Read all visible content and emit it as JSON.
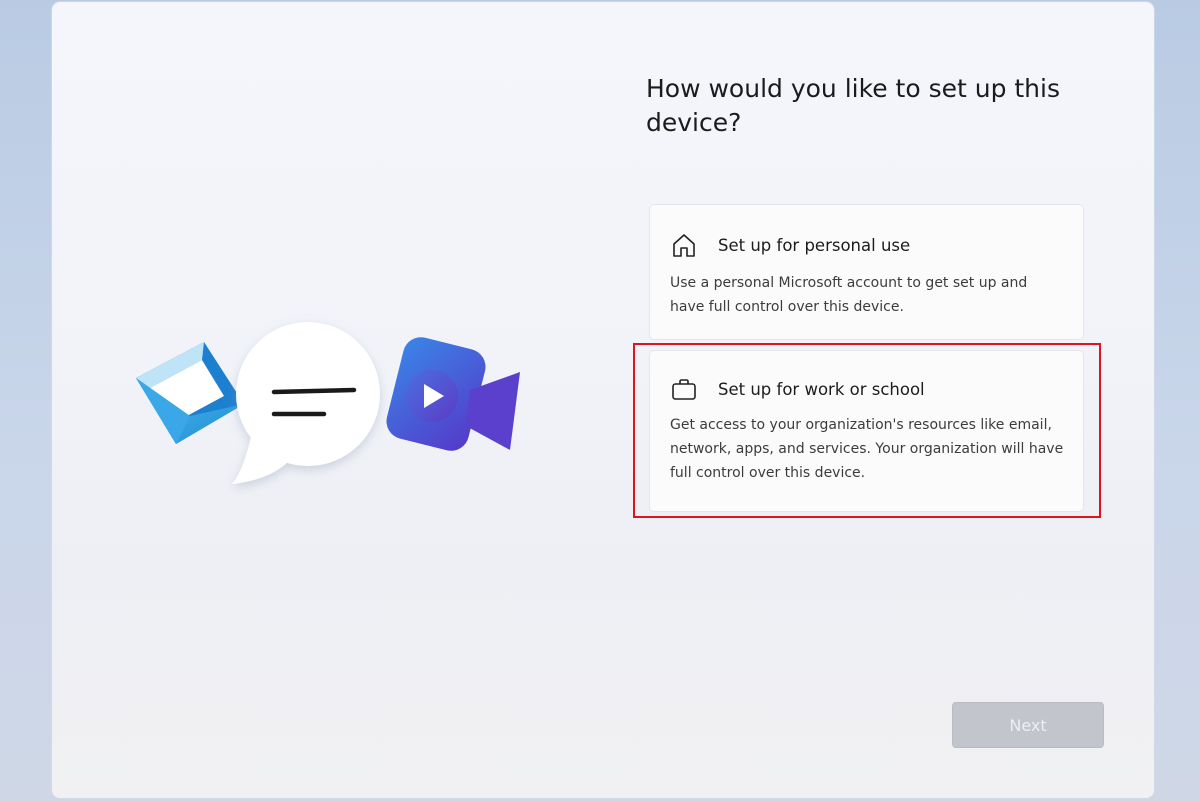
{
  "main": {
    "title": "How would you like to set up this device?"
  },
  "options": [
    {
      "title": "Set up for personal use",
      "description": "Use a personal Microsoft account to get set up and have full control over this device.",
      "icon": "home-icon"
    },
    {
      "title": "Set up for work or school",
      "description": "Get access to your organization's resources like email, network, apps, and services. Your organization will have full control over this device.",
      "icon": "briefcase-icon"
    }
  ],
  "footer": {
    "next_label": "Next"
  },
  "annotation": {
    "highlight_color": "#e0141e",
    "highlighted_option": "Set up for work or school"
  },
  "colors": {
    "mail_blue": "#2b9be0",
    "video_purple": "#4f4fd8",
    "button_disabled": "#c2c5cb"
  }
}
